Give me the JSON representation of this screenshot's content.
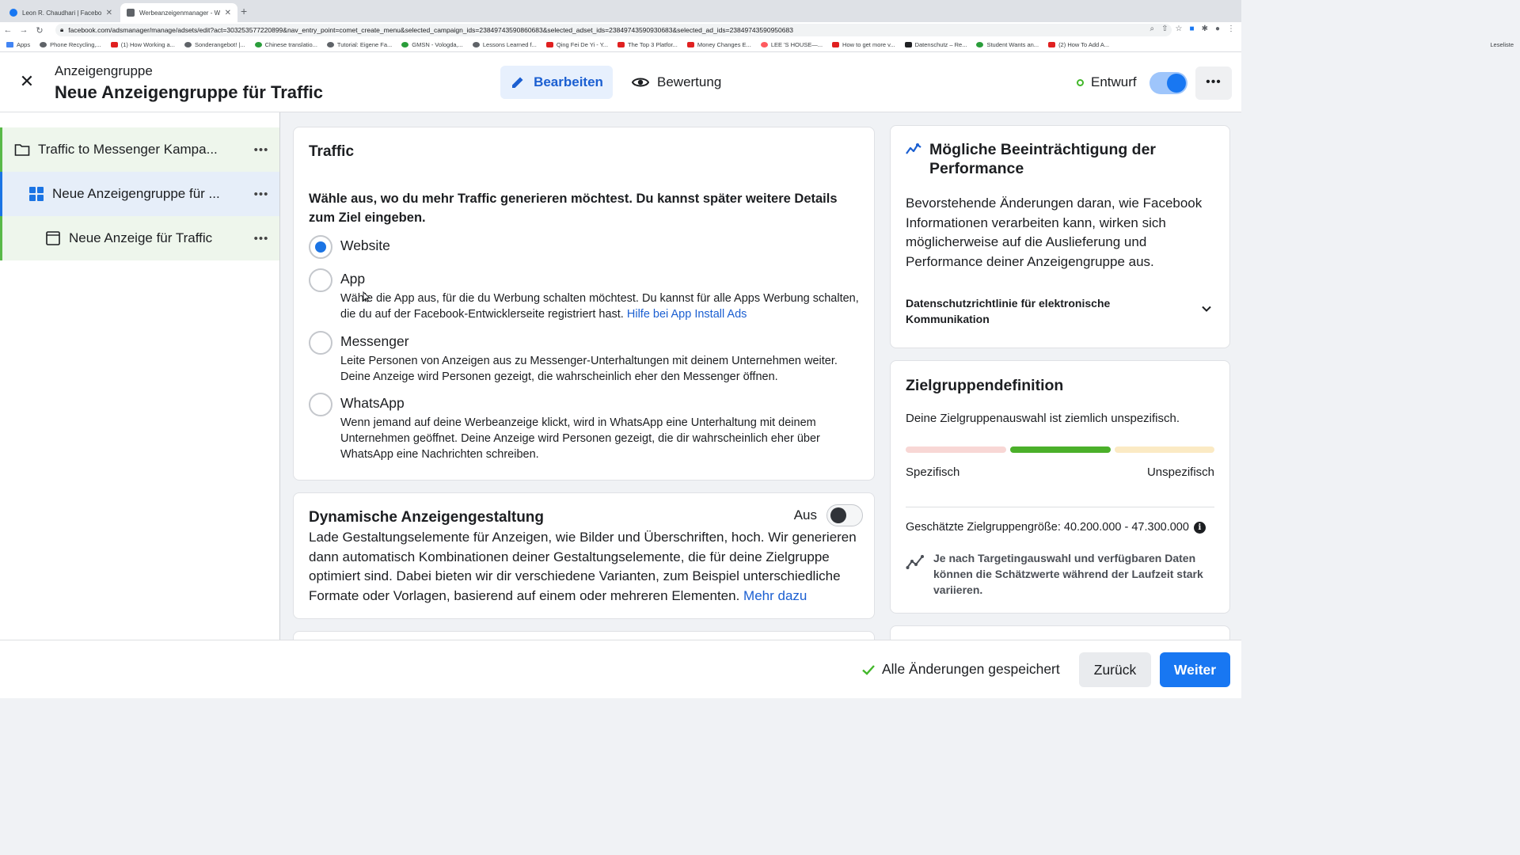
{
  "browser": {
    "tabs": [
      {
        "label": "Leon R. Chaudhari | Facebook",
        "active": false
      },
      {
        "label": "Werbeanzeigenmanager - Wer",
        "active": true
      }
    ],
    "url": "facebook.com/adsmanager/manage/adsets/edit?act=303253577220899&nav_entry_point=comet_create_menu&selected_campaign_ids=23849743590860683&selected_adset_ids=23849743590930683&selected_ad_ids=23849743590950683",
    "bookmarks": [
      "Apps",
      "Phone Recycling,...",
      "(1) How Working a...",
      "Sonderangebot! |...",
      "Chinese translatio...",
      "Tutorial: Eigene Fa...",
      "GMSN - Vologda,...",
      "Lessons Learned f...",
      "Qing Fei De Yi - Y...",
      "The Top 3 Platfor...",
      "Money Changes E...",
      "LEE 'S HOUSE—...",
      "How to get more v...",
      "Datenschutz – Re...",
      "Student Wants an...",
      "(2) How To Add A..."
    ],
    "reading_list": "Leseliste"
  },
  "header": {
    "subtitle": "Anzeigengruppe",
    "title": "Neue Anzeigengruppe für Traffic",
    "edit_label": "Bearbeiten",
    "review_label": "Bewertung",
    "status_label": "Entwurf",
    "more_label": "•••"
  },
  "sidebar": {
    "items": [
      {
        "label": "Traffic to Messenger Kampa...",
        "dots": "•••"
      },
      {
        "label": "Neue Anzeigengruppe für ...",
        "dots": "•••"
      },
      {
        "label": "Neue Anzeige für Traffic",
        "dots": "•••"
      }
    ]
  },
  "traffic": {
    "title": "Traffic",
    "lead": "Wähle aus, wo du mehr Traffic generieren möchtest. Du kannst später weitere Details zum Ziel eingeben.",
    "options": [
      {
        "name": "Website",
        "desc": "",
        "link": "",
        "selected": true
      },
      {
        "name": "App",
        "desc": "Wähle die App aus, für die du Werbung schalten möchtest. Du kannst für alle Apps Werbung schalten, die du auf der Facebook-Entwicklerseite registriert hast. ",
        "link": "Hilfe bei App Install Ads",
        "selected": false
      },
      {
        "name": "Messenger",
        "desc": "Leite Personen von Anzeigen aus zu Messenger-Unterhaltungen mit deinem Unternehmen weiter. Deine Anzeige wird Personen gezeigt, die wahrscheinlich eher den Messenger öffnen.",
        "link": "",
        "selected": false
      },
      {
        "name": "WhatsApp",
        "desc": "Wenn jemand auf deine Werbeanzeige klickt, wird in WhatsApp eine Unterhaltung mit deinem Unternehmen geöffnet. Deine Anzeige wird Personen gezeigt, die dir wahrscheinlich eher über WhatsApp eine Nachrichten schreiben.",
        "link": "",
        "selected": false
      }
    ]
  },
  "dynamic": {
    "title": "Dynamische Anzeigengestaltung",
    "toggle_label": "Aus",
    "desc": "Lade Gestaltungselemente für Anzeigen, wie Bilder und Überschriften, hoch. Wir generieren dann automatisch Kombinationen deiner Gestaltungselemente, die für deine Zielgruppe optimiert sind. Dabei bieten wir dir verschiedene Varianten, zum Beispiel unterschiedliche Formate oder Vorlagen, basierend auf einem oder mehreren Elementen. ",
    "link": "Mehr dazu"
  },
  "performance": {
    "title": "Mögliche Beeinträchtigung der Performance",
    "text": "Bevorstehende Änderungen daran, wie Facebook Informationen verarbeiten kann, wirken sich möglicherweise auf die Auslieferung und Performance deiner Anzeigengruppe aus.",
    "privacy": "Datenschutzrichtlinie für elektronische Kommunikation"
  },
  "audience": {
    "title": "Zielgruppendefinition",
    "text": "Deine Zielgruppenauswahl ist ziemlich unspezifisch.",
    "label_left": "Spezifisch",
    "label_right": "Unspezifisch",
    "size_label": "Geschätzte Zielgruppengröße: 40.200.000 - 47.300.000",
    "note": "Je nach Targetingauswahl und verfügbaren Daten können die Schätzwerte während der Laufzeit stark variieren."
  },
  "footer": {
    "saved_label": "Alle Änderungen gespeichert",
    "back_label": "Zurück",
    "next_label": "Weiter"
  },
  "colors": {
    "accent": "#1877f2",
    "link": "#1b5fd1",
    "meter_active": "#4bb02a",
    "draft_dot": "#42b72a"
  }
}
